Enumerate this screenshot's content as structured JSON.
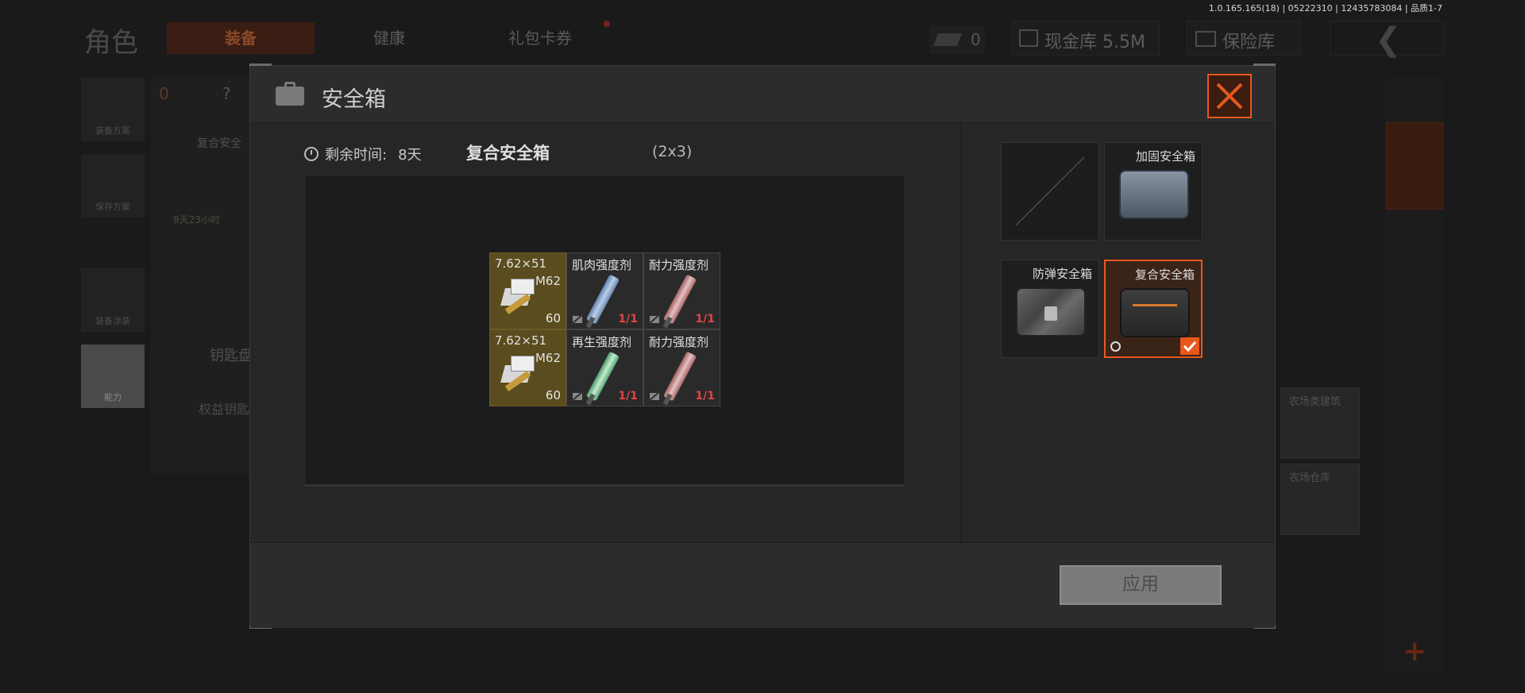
{
  "background": {
    "title": "角色",
    "tabs": [
      "装备",
      "健康",
      "礼包卡券"
    ],
    "ticket_count": "0",
    "cash_vault": "现金库 5.5M",
    "insurance": "保险库",
    "left_buttons": [
      "装备方案",
      "保存方案",
      "装备涂装",
      "能力"
    ],
    "orange_count": "0",
    "help": "?",
    "panel_label": "复合安全",
    "panel_timer": "8天23小时",
    "key_label": "钥匙盘",
    "key_item": "权益钥匙",
    "right_cards": [
      "农场类建筑",
      "农场仓库"
    ]
  },
  "version": "1.0.165.165(18) | 05222310 | 12435783084 | 品质1-7",
  "modal": {
    "title": "安全箱",
    "time_label": "剩余时间:",
    "time_value": "8天",
    "case_name": "复合安全箱",
    "case_size": "(2x3)",
    "grid": [
      {
        "name": "7.62×51",
        "sub": "M62",
        "count": "60",
        "type": "ammo"
      },
      {
        "name": "肌肉强度剂",
        "use": "1/1",
        "type": "syringe",
        "color": "#7fa1d4"
      },
      {
        "name": "耐力强度剂",
        "use": "1/1",
        "type": "syringe",
        "color": "#d9a3a3"
      },
      {
        "name": "7.62×51",
        "sub": "M62",
        "count": "60",
        "type": "ammo"
      },
      {
        "name": "再生强度剂",
        "use": "1/1",
        "type": "syringe",
        "color": "#8fd0a4"
      },
      {
        "name": "耐力强度剂",
        "use": "1/1",
        "type": "syringe",
        "color": "#d9a3a3"
      }
    ],
    "options": [
      {
        "label": "",
        "state": "empty"
      },
      {
        "label": "加固安全箱",
        "state": "normal"
      },
      {
        "label": "防弹安全箱",
        "state": "normal"
      },
      {
        "label": "复合安全箱",
        "state": "selected"
      }
    ],
    "apply_label": "应用",
    "accent": "#e8581c"
  }
}
